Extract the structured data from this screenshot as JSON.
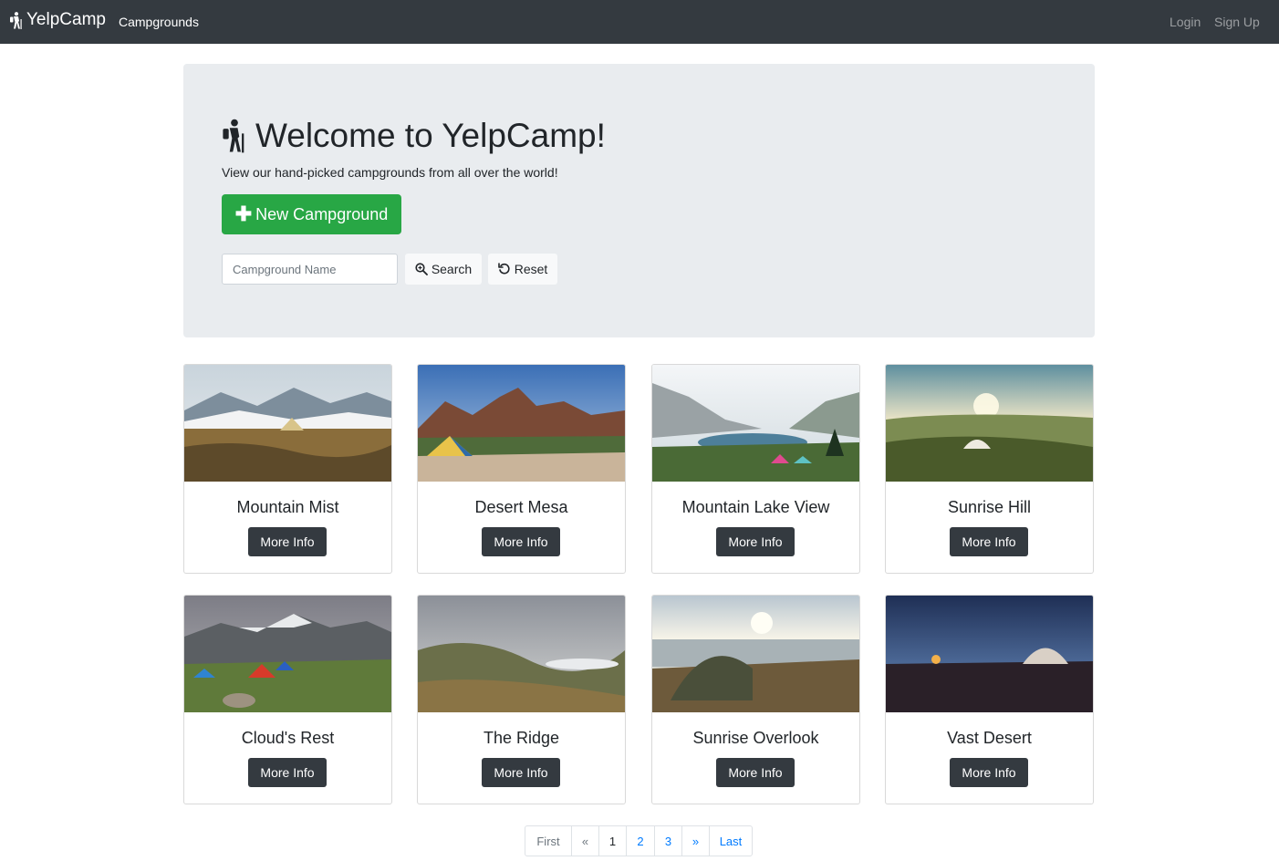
{
  "navbar": {
    "brand": "YelpCamp",
    "campgrounds": "Campgrounds",
    "login": "Login",
    "signup": "Sign Up"
  },
  "jumbotron": {
    "title": "Welcome to YelpCamp!",
    "subtitle": "View our hand-picked campgrounds from all over the world!",
    "new_button": "New Campground",
    "search_placeholder": "Campground Name",
    "search_button": "Search",
    "reset_button": "Reset"
  },
  "campgrounds": [
    {
      "name": "Mountain Mist",
      "button": "More Info"
    },
    {
      "name": "Desert Mesa",
      "button": "More Info"
    },
    {
      "name": "Mountain Lake View",
      "button": "More Info"
    },
    {
      "name": "Sunrise Hill",
      "button": "More Info"
    },
    {
      "name": "Cloud's Rest",
      "button": "More Info"
    },
    {
      "name": "The Ridge",
      "button": "More Info"
    },
    {
      "name": "Sunrise Overlook",
      "button": "More Info"
    },
    {
      "name": "Vast Desert",
      "button": "More Info"
    }
  ],
  "pagination": {
    "first": "First",
    "prev": "«",
    "pages": [
      "1",
      "2",
      "3"
    ],
    "current": "1",
    "next": "»",
    "last": "Last"
  },
  "colors": {
    "navbar": "#343a40",
    "jumbotron": "#e9ecef",
    "success": "#28a745",
    "link": "#007bff"
  }
}
